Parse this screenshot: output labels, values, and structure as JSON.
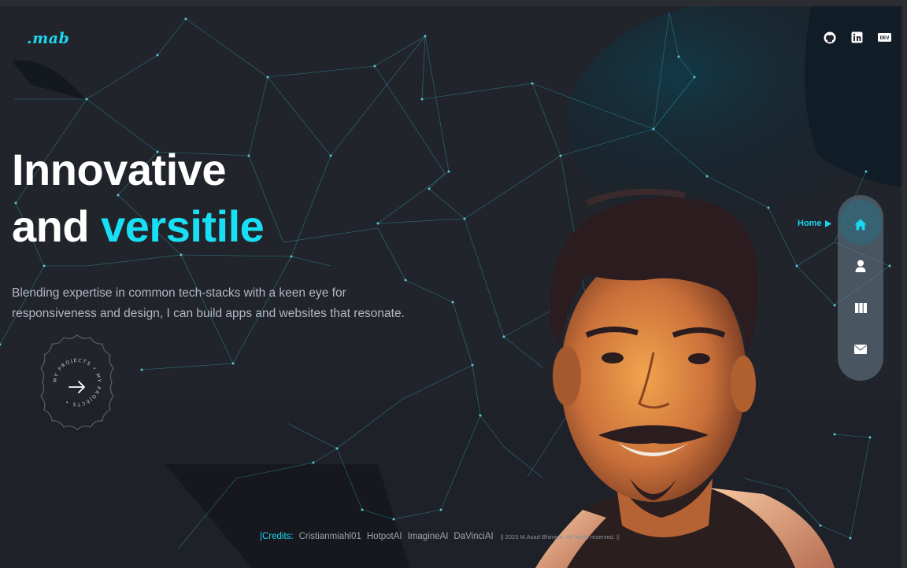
{
  "header": {
    "logo": ".mab",
    "social": [
      {
        "icon": "github-icon"
      },
      {
        "icon": "linkedin-icon"
      },
      {
        "icon": "dev-icon",
        "text": "DEV"
      }
    ]
  },
  "hero": {
    "line1": "Innovative",
    "line2_plain": "and",
    "line2_accent": "versitile",
    "subtitle_line1": "Blending expertise in common tech-stacks with a keen eye for",
    "subtitle_line2": "responsiveness and design, I can build apps and websites that resonate."
  },
  "badge": {
    "text": "MY PROJECTS • MY PROJECTS •",
    "icon": "arrow-right-icon"
  },
  "nav": {
    "active_label": "Home",
    "items": [
      {
        "icon": "home-icon"
      },
      {
        "icon": "user-icon"
      },
      {
        "icon": "projects-icon"
      },
      {
        "icon": "mail-icon"
      }
    ]
  },
  "footer": {
    "credits_label": "|Credits:",
    "credits": [
      "Cristianmiahl01",
      "HotpotAI",
      "ImagineAI",
      "DaVinciAI"
    ],
    "copyright": "|| 2023 M.Asad Bhimjee. All rights reserved. ||"
  },
  "colors": {
    "accent": "#18dff3",
    "background": "#22242b",
    "text": "#ffffff",
    "muted": "#b3b7c2"
  }
}
